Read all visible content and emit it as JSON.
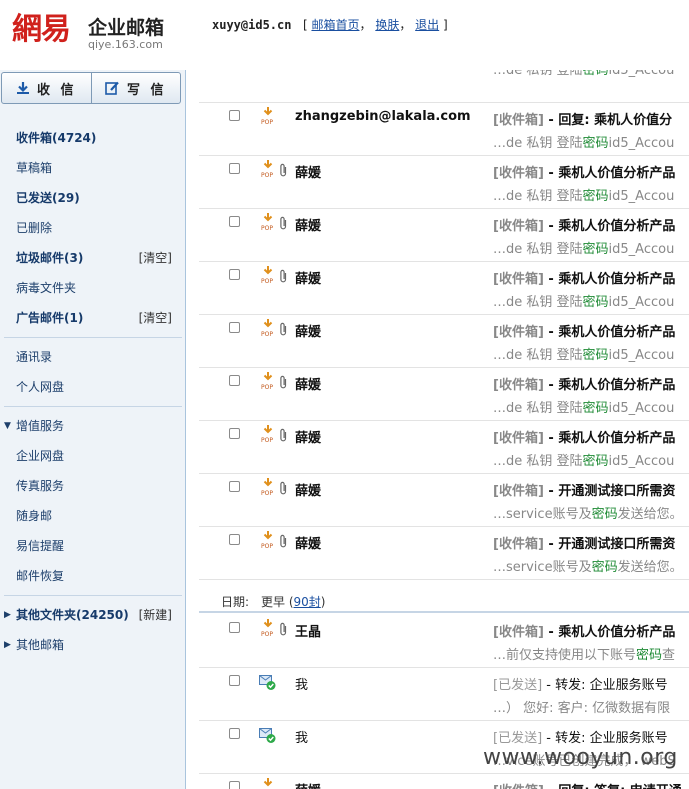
{
  "header": {
    "logo_mark": "網易",
    "logo_title": "企业邮箱",
    "logo_domain": "qiye.163.com",
    "user_email": "xuyy@id5.cn",
    "bracket_open": "[",
    "bracket_close": "]",
    "links": [
      {
        "label": "邮箱首页"
      },
      {
        "label": "换肤"
      },
      {
        "label": "退出"
      }
    ],
    "sep1": "，",
    "sep2": "，"
  },
  "toolbar": {
    "receive_label": "收 信",
    "compose_label": "写 信"
  },
  "sidebar": {
    "items": [
      {
        "label": "收件箱",
        "count": "(4724)",
        "bold": true
      },
      {
        "label": "草稿箱"
      },
      {
        "label": "已发送",
        "count": "(29)",
        "bold": true
      },
      {
        "label": "已删除"
      },
      {
        "label": "垃圾邮件",
        "count": "(3)",
        "bold": true,
        "action": "[清空]"
      },
      {
        "label": "病毒文件夹"
      },
      {
        "label": "广告邮件",
        "count": "(1)",
        "bold": true,
        "action": "[清空]"
      }
    ],
    "contacts": "通讯录",
    "netdisk": "个人网盘",
    "vas_header": "增值服务",
    "vas_items": [
      "企业网盘",
      "传真服务",
      "随身邮",
      "易信提醒",
      "邮件恢复"
    ],
    "other_folders": {
      "label": "其他文件夹",
      "count": "(24250)",
      "action": "[新建]"
    },
    "other_mailbox": "其他邮箱"
  },
  "mail_rows": [
    {
      "snippet": "…de 私钥 登陆",
      "hl": "密码",
      "snippet_tail": "id5_Accou",
      "partial_top": true
    },
    {
      "sender": "zhangzebin@lakala.com",
      "pop": true,
      "clip": false,
      "folder": "[收件箱]",
      "title": "- 回复: 乘机人价值分",
      "snippet": "…de 私钥 登陆",
      "hl": "密码",
      "snippet_tail": "id5_Accou"
    },
    {
      "sender": "薛媛",
      "pop": true,
      "clip": true,
      "folder": "[收件箱]",
      "title": "- 乘机人价值分析产品",
      "snippet": "…de 私钥 登陆",
      "hl": "密码",
      "snippet_tail": "id5_Accou"
    },
    {
      "sender": "薛媛",
      "pop": true,
      "clip": true,
      "folder": "[收件箱]",
      "title": "- 乘机人价值分析产品",
      "snippet": "…de 私钥 登陆",
      "hl": "密码",
      "snippet_tail": "id5_Accou"
    },
    {
      "sender": "薛媛",
      "pop": true,
      "clip": true,
      "folder": "[收件箱]",
      "title": "- 乘机人价值分析产品",
      "snippet": "…de 私钥 登陆",
      "hl": "密码",
      "snippet_tail": "id5_Accou"
    },
    {
      "sender": "薛媛",
      "pop": true,
      "clip": true,
      "folder": "[收件箱]",
      "title": "- 乘机人价值分析产品",
      "snippet": "…de 私钥 登陆",
      "hl": "密码",
      "snippet_tail": "id5_Accou"
    },
    {
      "sender": "薛媛",
      "pop": true,
      "clip": true,
      "folder": "[收件箱]",
      "title": "- 乘机人价值分析产品",
      "snippet": "…de 私钥 登陆",
      "hl": "密码",
      "snippet_tail": "id5_Accou"
    },
    {
      "sender": "薛媛",
      "pop": true,
      "clip": true,
      "folder": "[收件箱]",
      "title": "- 乘机人价值分析产品",
      "snippet": "…de 私钥 登陆",
      "hl": "密码",
      "snippet_tail": "id5_Accou"
    },
    {
      "sender": "薛媛",
      "pop": true,
      "clip": true,
      "folder": "[收件箱]",
      "title": "- 开通测试接口所需资",
      "snippet": "…service账号及",
      "hl": "密码",
      "snippet_tail": "发送给您。"
    },
    {
      "sender": "薛媛",
      "pop": true,
      "clip": true,
      "folder": "[收件箱]",
      "title": "- 开通测试接口所需资",
      "snippet": "…service账号及",
      "hl": "密码",
      "snippet_tail": "发送给您。"
    }
  ],
  "date_group": {
    "label": "日期:",
    "value": "更早 (",
    "link": "90封",
    "close": ")"
  },
  "mail_rows_earlier": [
    {
      "sender": "王晶",
      "pop": true,
      "clip": true,
      "folder": "[收件箱]",
      "title": "- 乘机人价值分析产品",
      "snippet": "…前仅支持使用以下账号",
      "hl": "密码",
      "snippet_tail": "查"
    },
    {
      "sender": "我",
      "sent": true,
      "folder": "[已发送]",
      "title": "- 转发: 企业服务账号",
      "snippet": "…）  您好:   客户: 亿微数据有限",
      "hl": "",
      "snippet_tail": ""
    },
    {
      "sender": "我",
      "sent": true,
      "folder": "[已发送]",
      "title": "- 转发: 企业服务账号",
      "snippet": "…vice账号已创建完成，  webS",
      "hl": "",
      "snippet_tail": ""
    },
    {
      "sender": "薛媛",
      "pop": true,
      "clip": false,
      "folder": "[收件箱]",
      "title": "- 回复: 答复: 申请开通",
      "snippet": "",
      "hl": "",
      "snippet_tail": "",
      "partial_bottom": true
    }
  ],
  "watermark": "www.wooyun.org",
  "colors": {
    "brand_red": "#d0211c",
    "link_blue": "#1a4fa0",
    "highlight_green": "#1e8a34"
  }
}
